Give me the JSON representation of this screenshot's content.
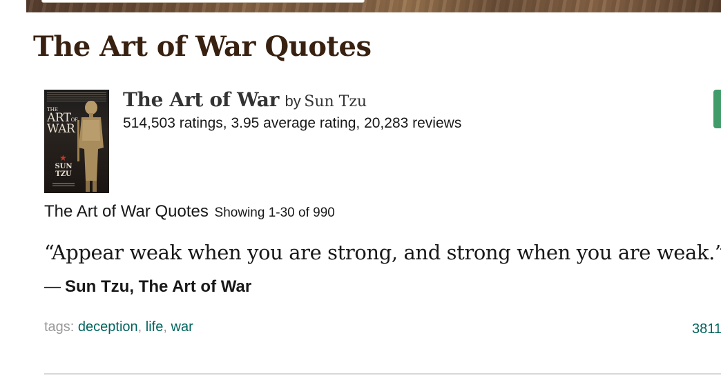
{
  "page": {
    "title": "The Art of War Quotes"
  },
  "book": {
    "title": "The Art of War",
    "by": "by",
    "author": "Sun Tzu",
    "stats": "514,503 ratings, 3.95 average rating, 20,283 reviews",
    "cover": {
      "title_small": "THE",
      "title_line1": "ART",
      "title_of": "OF",
      "title_line2": "WAR",
      "author_line1": "SUN",
      "author_line2": "TZU"
    }
  },
  "quotes_section": {
    "heading": "The Art of War Quotes",
    "showing": "Showing 1-30 of 990"
  },
  "quote": {
    "text": "“Appear weak when you are strong, and strong when you are weak.”",
    "dash": "―",
    "attribution": "Sun Tzu, The Art of War",
    "tags_label": "tags:",
    "tags": [
      "deception",
      "life",
      "war"
    ],
    "separator": ",",
    "likes": "3811"
  },
  "colors": {
    "title_brown": "#382110",
    "tag_link": "#00635d",
    "green_tab": "#409d69"
  }
}
